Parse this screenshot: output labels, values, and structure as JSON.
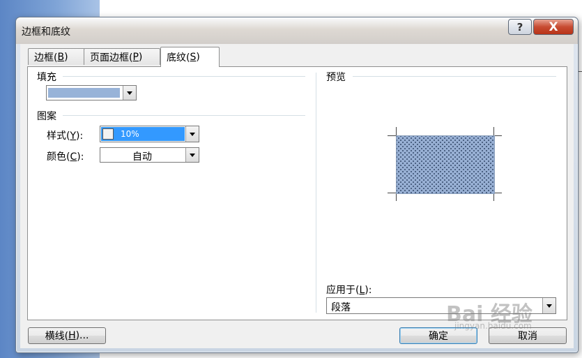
{
  "dialog": {
    "title": "边框和底纹",
    "help_label": "?",
    "close_label": "X"
  },
  "tabs": [
    {
      "label": "边框(",
      "key": "B",
      "suffix": ")"
    },
    {
      "label": "页面边框(",
      "key": "P",
      "suffix": ")"
    },
    {
      "label": "底纹(",
      "key": "S",
      "suffix": ")"
    }
  ],
  "fill": {
    "heading": "填充",
    "color": "#98b3d8"
  },
  "pattern": {
    "heading": "图案",
    "style_label": "样式(",
    "style_key": "Y",
    "style_suffix": "):",
    "style_value": "10%",
    "color_label": "颜色(",
    "color_key": "C",
    "color_suffix": "):",
    "color_value": "自动"
  },
  "preview": {
    "heading": "预览"
  },
  "apply": {
    "label": "应用于(",
    "key": "L",
    "suffix": "):",
    "value": "段落"
  },
  "buttons": {
    "hline_label": "横线(",
    "hline_key": "H",
    "hline_suffix": ")...",
    "ok_label": "确定",
    "cancel_label": "取消"
  },
  "watermark": {
    "main": "Bai 经验",
    "sub": "jingyan.baidu.com"
  },
  "colors": {
    "selection": "#3399ff",
    "shading": "#97afd3",
    "close": "#c84c32"
  }
}
